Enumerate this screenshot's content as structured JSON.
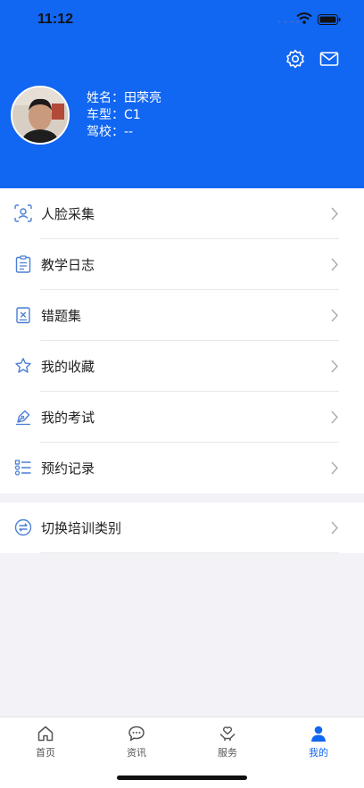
{
  "status_bar": {
    "time": "11:12"
  },
  "header": {
    "settings_icon": "gear-icon",
    "message_icon": "envelope-icon",
    "profile": {
      "name_label": "姓名：",
      "name_value": "田荣亮",
      "car_type_label": "车型：",
      "car_type_value": "C1",
      "school_label": "驾校：",
      "school_value": "--"
    }
  },
  "menu": {
    "items": [
      {
        "label": "人脸采集",
        "icon": "face-scan-icon"
      },
      {
        "label": "教学日志",
        "icon": "clipboard-icon"
      },
      {
        "label": "错题集",
        "icon": "wrong-questions-icon"
      },
      {
        "label": "我的收藏",
        "icon": "star-icon"
      },
      {
        "label": "我的考试",
        "icon": "pen-icon"
      },
      {
        "label": "预约记录",
        "icon": "list-icon"
      }
    ],
    "switch_item": {
      "label": "切换培训类别",
      "icon": "switch-icon"
    }
  },
  "tabbar": {
    "tabs": [
      {
        "label": "首页",
        "icon": "home-icon"
      },
      {
        "label": "资讯",
        "icon": "chat-icon"
      },
      {
        "label": "服务",
        "icon": "heart-hand-icon"
      },
      {
        "label": "我的",
        "icon": "person-icon"
      }
    ],
    "active_index": 3,
    "accent_color": "#1166f2"
  }
}
